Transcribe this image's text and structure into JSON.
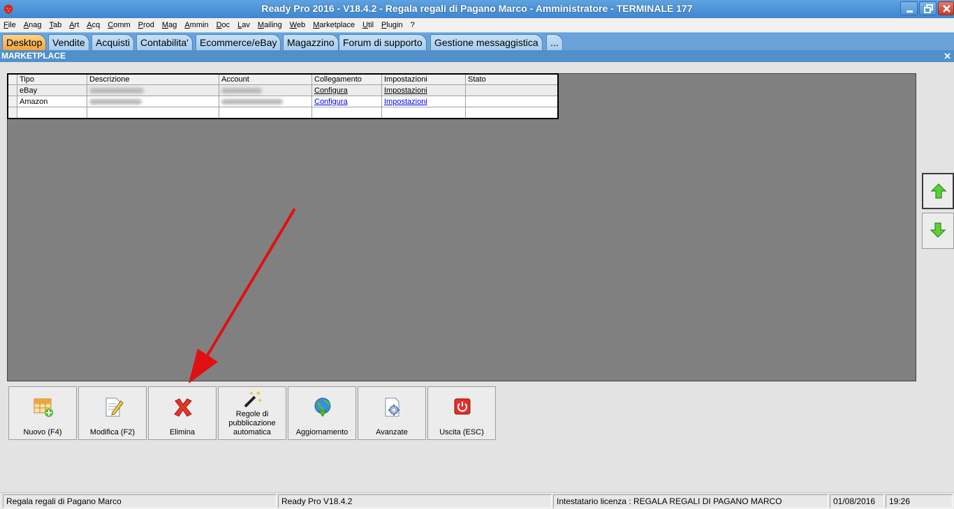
{
  "window": {
    "title": "Ready Pro 2016 - V18.4.2 - Regala regali di Pagano Marco - Amministratore - TERMINALE 177"
  },
  "menu": [
    {
      "label": "File",
      "ul": "F",
      "rest": "ile"
    },
    {
      "label": "Anag",
      "ul": "A",
      "rest": "nag"
    },
    {
      "label": "Tab",
      "ul": "T",
      "rest": "ab"
    },
    {
      "label": "Art",
      "ul": "A",
      "rest": "rt"
    },
    {
      "label": "Acq",
      "ul": "A",
      "rest": "cq"
    },
    {
      "label": "Comm",
      "ul": "C",
      "rest": "omm"
    },
    {
      "label": "Prod",
      "ul": "P",
      "rest": "rod"
    },
    {
      "label": "Mag",
      "ul": "M",
      "rest": "ag"
    },
    {
      "label": "Ammin",
      "ul": "A",
      "rest": "mmin"
    },
    {
      "label": "Doc",
      "ul": "D",
      "rest": "oc"
    },
    {
      "label": "Lav",
      "ul": "L",
      "rest": "av"
    },
    {
      "label": "Mailing",
      "ul": "M",
      "rest": "ailing"
    },
    {
      "label": "Web",
      "ul": "W",
      "rest": "eb"
    },
    {
      "label": "Marketplace",
      "ul": "M",
      "rest": "arketplace"
    },
    {
      "label": "Util",
      "ul": "U",
      "rest": "til"
    },
    {
      "label": "Plugin",
      "ul": "P",
      "rest": "lugin"
    },
    {
      "label": "?",
      "ul": "",
      "rest": "?"
    }
  ],
  "tabs": [
    {
      "label": "Desktop",
      "active": true
    },
    {
      "label": "Vendite",
      "active": false
    },
    {
      "label": "Acquisti",
      "active": false
    },
    {
      "label": "Contabilita'",
      "active": false
    },
    {
      "label": "Ecommerce/eBay",
      "active": false
    },
    {
      "label": "Magazzino",
      "active": false
    },
    {
      "label": "Forum di supporto",
      "active": false
    },
    {
      "label": "Gestione messaggistica",
      "active": false
    },
    {
      "label": "...",
      "active": false
    }
  ],
  "panel": {
    "title": "MARKETPLACE",
    "close_label": "✕"
  },
  "grid": {
    "columns": [
      "Tipo",
      "Descrizione",
      "Account",
      "Collegamento",
      "Impostazioni",
      "Stato"
    ],
    "rows": [
      {
        "tipo": "eBay",
        "collegamento": "Configura",
        "impostazioni": "Impostazioni",
        "stato": ""
      },
      {
        "tipo": "Amazon",
        "collegamento": "Configura",
        "impostazioni": "Impostazioni",
        "stato": ""
      }
    ]
  },
  "toolbar": {
    "nuovo": "Nuovo (F4)",
    "modifica": "Modifica (F2)",
    "elimina": "Elimina",
    "regole_1": "Regole di",
    "regole_2": "pubblicazione",
    "regole_3": "automatica",
    "aggiornamento": "Aggiornamento",
    "avanzate": "Avanzate",
    "uscita": "Uscita (ESC)"
  },
  "side": {
    "up_icon": "arrow-up-icon",
    "down_icon": "arrow-down-icon"
  },
  "status": {
    "company": "Regala regali di Pagano Marco",
    "version": "Ready Pro V18.4.2",
    "license": "Intestatario licenza : REGALA REGALI DI PAGANO MARCO",
    "date": "01/08/2016",
    "time": "19:26"
  },
  "colors": {
    "titlebar": "#4f93d6",
    "tab_active": "#f5a53a",
    "tabs_bar": "#6aa3da",
    "panel_header": "#5290cc",
    "grid_background": "#808080",
    "annotation_arrow": "#e01010"
  }
}
